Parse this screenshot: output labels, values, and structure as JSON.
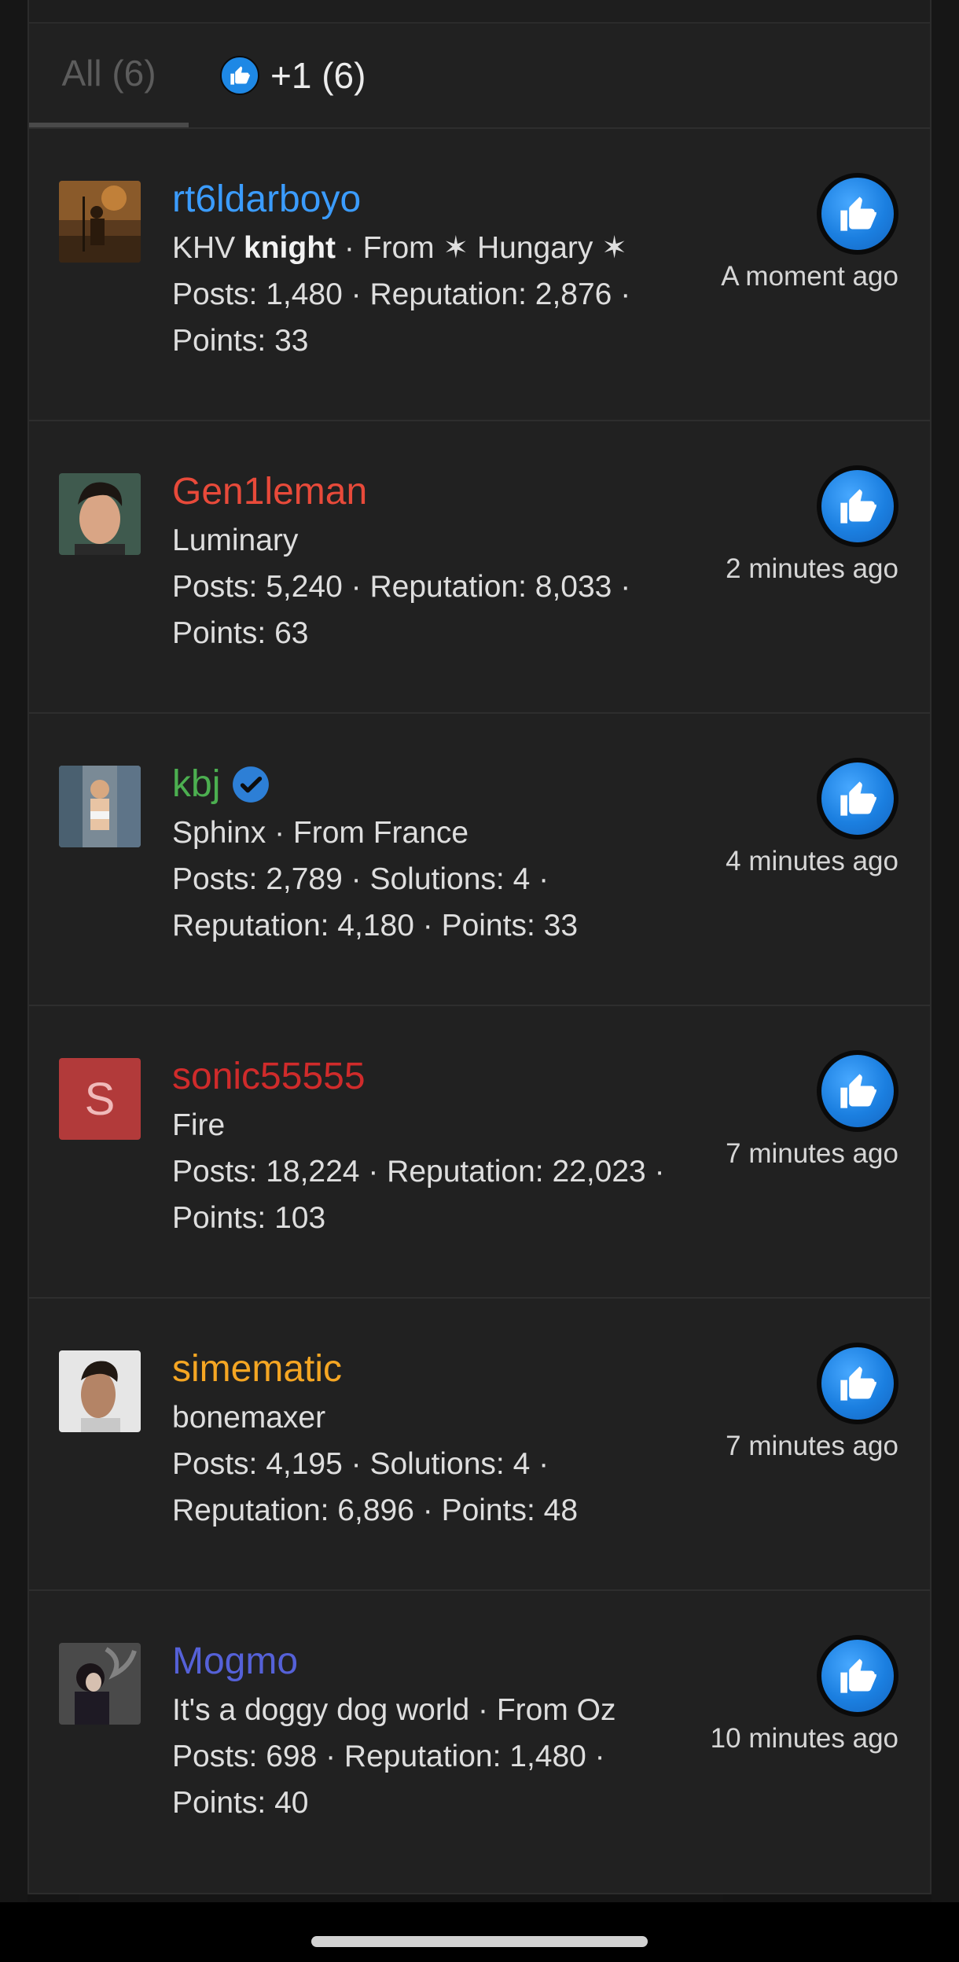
{
  "tabs": [
    {
      "label": "All (6)",
      "active": true
    },
    {
      "label": "+1 (6)",
      "icon": "thumbs-up-icon"
    }
  ],
  "colors": {
    "accent": "#1e88e5",
    "name_blue": "#3b9cff",
    "name_red": "#e84a3a",
    "name_green": "#4caf50",
    "name_darkred": "#d02b2b",
    "name_orange": "#f5a623",
    "name_indigo": "#5561d8"
  },
  "reactions": [
    {
      "username": "rt6ldarboyo",
      "name_color": "#3b9cff",
      "title_prefix": "KHV ",
      "title_bold": "knight",
      "title_suffix": " · From ✶ Hungary ✶",
      "stats_line1": "Posts: 1,480 · Reputation: 2,876 ·",
      "stats_line2": "Points: 33",
      "time": "A moment ago",
      "avatar": "warrior-image"
    },
    {
      "username": "Gen1leman",
      "name_color": "#e84a3a",
      "title_prefix": "Luminary",
      "title_bold": "",
      "title_suffix": "",
      "stats_line1": "Posts: 5,240 · Reputation: 8,033 ·",
      "stats_line2": "Points: 63",
      "time": "2 minutes ago",
      "avatar": "man-portrait-image"
    },
    {
      "username": "kbj",
      "name_color": "#4caf50",
      "verified": true,
      "title_prefix": "Sphinx · From France",
      "title_bold": "",
      "title_suffix": "",
      "stats_line1": "Posts: 2,789 · Solutions: 4 ·",
      "stats_line2": "Reputation: 4,180 · Points: 33",
      "time": "4 minutes ago",
      "avatar": "woman-photo-image"
    },
    {
      "username": "sonic55555",
      "name_color": "#d02b2b",
      "title_prefix": "Fire",
      "title_bold": "",
      "title_suffix": "",
      "stats_line1": "Posts: 18,224 · Reputation: 22,023 ·",
      "stats_line2": "Points: 103",
      "time": "7 minutes ago",
      "avatar_letter": "S"
    },
    {
      "username": "simematic",
      "name_color": "#f5a623",
      "title_prefix": "bonemaxer",
      "title_bold": "",
      "title_suffix": "",
      "stats_line1": "Posts: 4,195 · Solutions: 4 ·",
      "stats_line2": "Reputation: 6,896 · Points: 48",
      "time": "7 minutes ago",
      "avatar": "man-profile-image"
    },
    {
      "username": "Mogmo",
      "name_color": "#5561d8",
      "title_prefix": "It's a doggy dog world · From Oz",
      "title_bold": "",
      "title_suffix": "",
      "stats_line1": "Posts: 698 · Reputation: 1,480 ·",
      "stats_line2": "Points: 40",
      "time": "10 minutes ago",
      "avatar": "smoking-figure-image"
    }
  ]
}
